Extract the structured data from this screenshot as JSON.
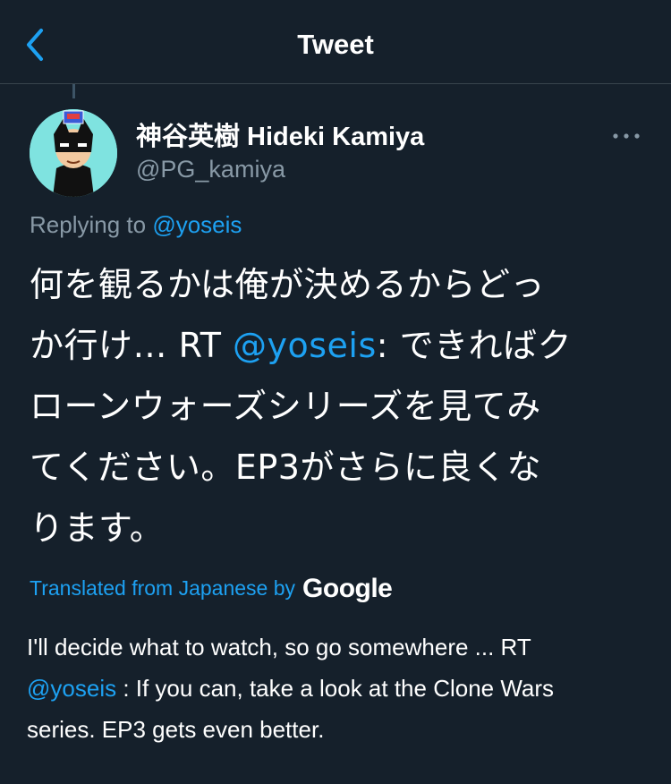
{
  "header": {
    "title": "Tweet",
    "back_icon": "chevron-left-icon"
  },
  "colors": {
    "background": "#15202b",
    "accent": "#1da1f2",
    "secondary_text": "#8899a6",
    "divider": "#38444d",
    "avatar_bg": "#7fe3e0"
  },
  "tweet": {
    "author": {
      "display_name": "神谷英樹 Hideki Kamiya",
      "handle": "@PG_kamiya"
    },
    "more_icon": "more-horizontal-icon",
    "replying_to": {
      "prefix": "Replying to",
      "mention": "@yoseis"
    },
    "text": {
      "line1": "何を観るかは俺が決めるからどっ",
      "line2_pre": "か行け… RT ",
      "line2_mention": "@yoseis",
      "line2_post": ": できればク",
      "line3": "ローンウォーズシリーズを見てみ",
      "line4": "てください。EP3がさらに良くな",
      "line5": "ります。"
    },
    "translation": {
      "label": "Translated from Japanese by",
      "provider": "Google",
      "line1": "I'll decide what to watch, so go somewhere ... RT",
      "line2_mention": "@yoseis",
      "line2_post": " : If you can, take a look at the Clone Wars",
      "line3": "series. EP3 gets even better."
    }
  }
}
